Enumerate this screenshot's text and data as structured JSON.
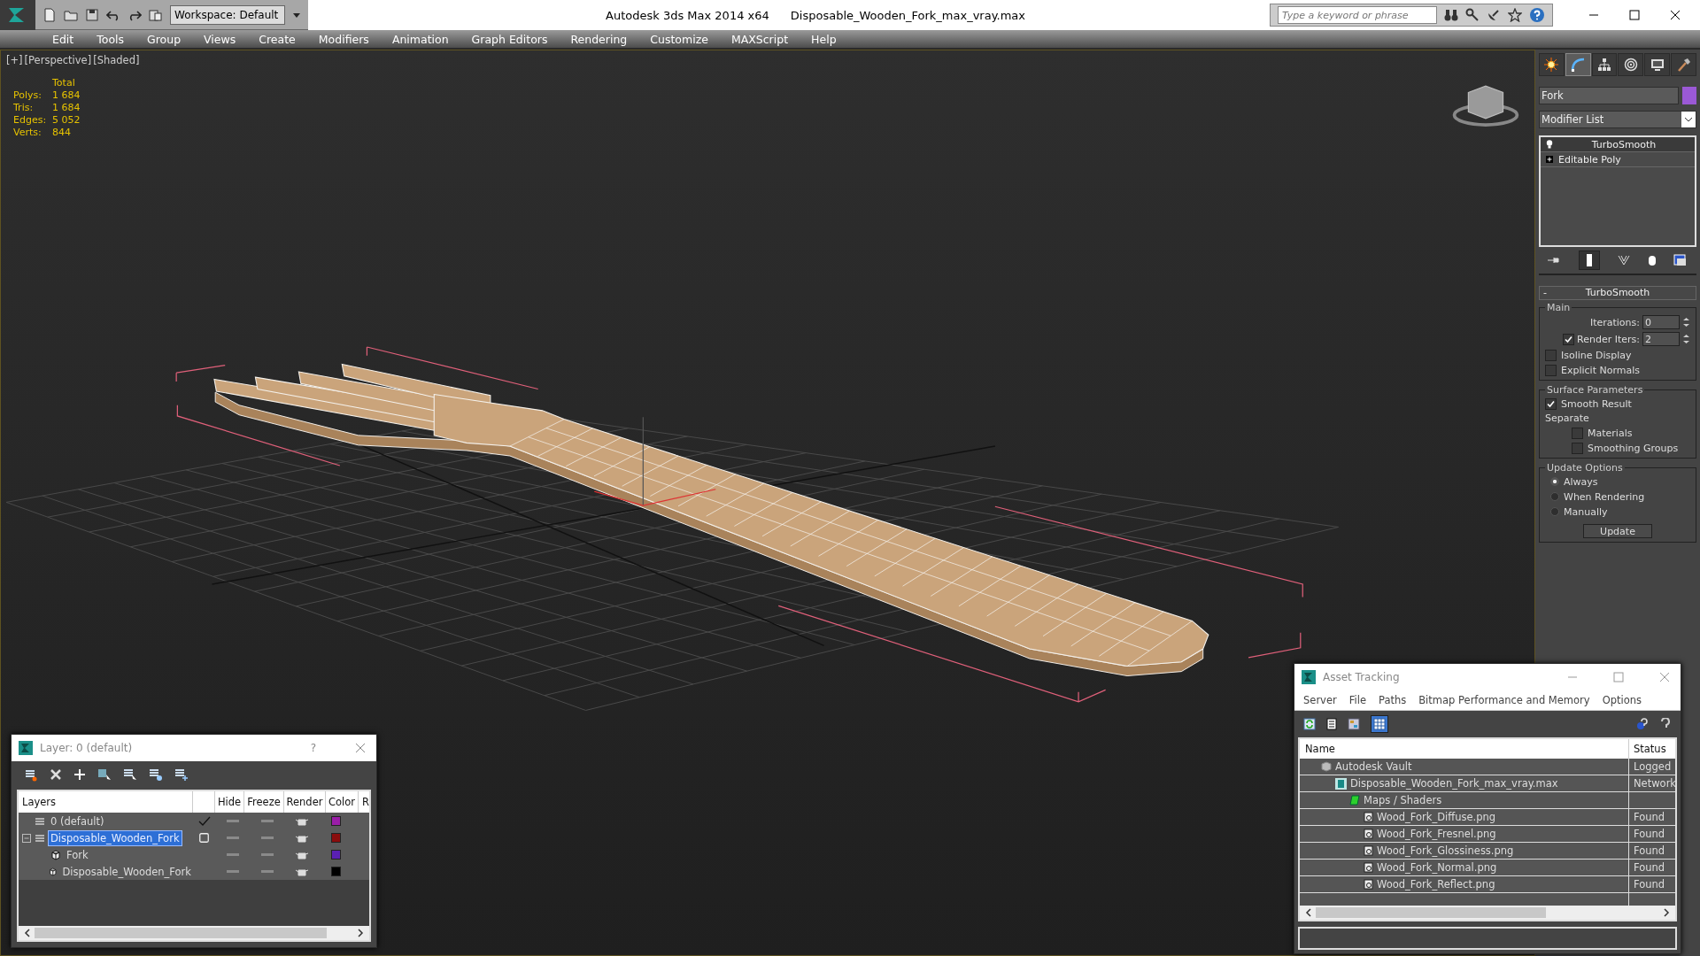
{
  "title_bar": {
    "workspace": "Workspace: Default",
    "app_title": "Autodesk 3ds Max  2014 x64",
    "file_name": "Disposable_Wooden_Fork_max_vray.max",
    "search": {
      "placeholder": "Type a keyword or phrase"
    }
  },
  "menu": [
    "Edit",
    "Tools",
    "Group",
    "Views",
    "Create",
    "Modifiers",
    "Animation",
    "Graph Editors",
    "Rendering",
    "Customize",
    "MAXScript",
    "Help"
  ],
  "viewport": {
    "labels": [
      "[+]",
      "[Perspective]",
      "[Shaded]"
    ],
    "stats": {
      "header": "Total",
      "rows": [
        {
          "label": "Polys:",
          "value": "1 684"
        },
        {
          "label": "Tris:",
          "value": "1 684"
        },
        {
          "label": "Edges:",
          "value": "5 052"
        },
        {
          "label": "Verts:",
          "value": "844"
        }
      ]
    }
  },
  "command_panel": {
    "tabs": [
      {
        "kind": "create",
        "selected": false
      },
      {
        "kind": "modify",
        "selected": true
      },
      {
        "kind": "hierarchy",
        "selected": false
      },
      {
        "kind": "motion",
        "selected": false
      },
      {
        "kind": "display",
        "selected": false
      },
      {
        "kind": "utilities",
        "selected": false
      }
    ],
    "object_name": "Fork",
    "modifier_list": "Modifier List",
    "stack": [
      {
        "label": "TurboSmooth",
        "kind": "modifier",
        "selected": true
      },
      {
        "label": "Editable Poly",
        "kind": "base",
        "selected": false
      }
    ],
    "rollout": {
      "collapse": "-",
      "title": "TurboSmooth",
      "main_group": "Main",
      "iterations": {
        "label": "Iterations:",
        "value": "0"
      },
      "render_iters": {
        "label": "Render Iters:",
        "value": "2",
        "checked": true
      },
      "main_options": [
        {
          "label": "Isoline Display",
          "checked": false
        },
        {
          "label": "Explicit Normals",
          "checked": false
        }
      ],
      "surface_group": "Surface Parameters",
      "smooth_result": {
        "label": "Smooth Result",
        "checked": true
      },
      "separate_label": "Separate",
      "separate_options": [
        {
          "label": "Materials",
          "checked": false
        },
        {
          "label": "Smoothing Groups",
          "checked": false
        }
      ],
      "update_group": "Update Options",
      "update_options": [
        {
          "label": "Always",
          "selected": true
        },
        {
          "label": "When Rendering",
          "selected": false
        },
        {
          "label": "Manually",
          "selected": false
        }
      ],
      "update_button": "Update"
    }
  },
  "layer_dialog": {
    "title": "Layer: 0 (default)",
    "help": "?",
    "columns": [
      "Layers",
      "Hide",
      "Freeze",
      "Render",
      "Color",
      "R"
    ],
    "layers": [
      {
        "name": "0 (default)",
        "kind": "layer",
        "active": true,
        "selected": false,
        "color": "#9a1ea8"
      },
      {
        "name": "Disposable_Wooden_Fork",
        "kind": "layer",
        "active": false,
        "selected": true,
        "expanded": true,
        "color": "#8a0c0c",
        "children": [
          {
            "name": "Fork",
            "kind": "object",
            "selected": false,
            "color": "#5a20b4"
          },
          {
            "name": "Disposable_Wooden_Fork",
            "kind": "object",
            "selected": false,
            "color": "#000000"
          }
        ]
      }
    ]
  },
  "asset_tracking": {
    "title": "Asset Tracking",
    "menu": [
      "Server",
      "File",
      "Paths",
      "Bitmap Performance and Memory",
      "Options"
    ],
    "columns": [
      "Name",
      "Status"
    ],
    "rows": [
      {
        "name": "Autodesk Vault",
        "kind": "vault",
        "status": "Logged",
        "children": [
          {
            "name": "Disposable_Wooden_Fork_max_vray.max",
            "kind": "scene",
            "status": "Network",
            "children": [
              {
                "name": "Maps / Shaders",
                "kind": "maps",
                "children": [
                  {
                    "name": "Wood_Fork_Diffuse.png",
                    "kind": "bitmap",
                    "status": "Found"
                  },
                  {
                    "name": "Wood_Fork_Fresnel.png",
                    "kind": "bitmap",
                    "status": "Found"
                  },
                  {
                    "name": "Wood_Fork_Glossiness.png",
                    "kind": "bitmap",
                    "status": "Found"
                  },
                  {
                    "name": "Wood_Fork_Normal.png",
                    "kind": "bitmap",
                    "status": "Found"
                  },
                  {
                    "name": "Wood_Fork_Reflect.png",
                    "kind": "bitmap",
                    "status": "Found"
                  }
                ]
              }
            ]
          }
        ]
      }
    ]
  }
}
